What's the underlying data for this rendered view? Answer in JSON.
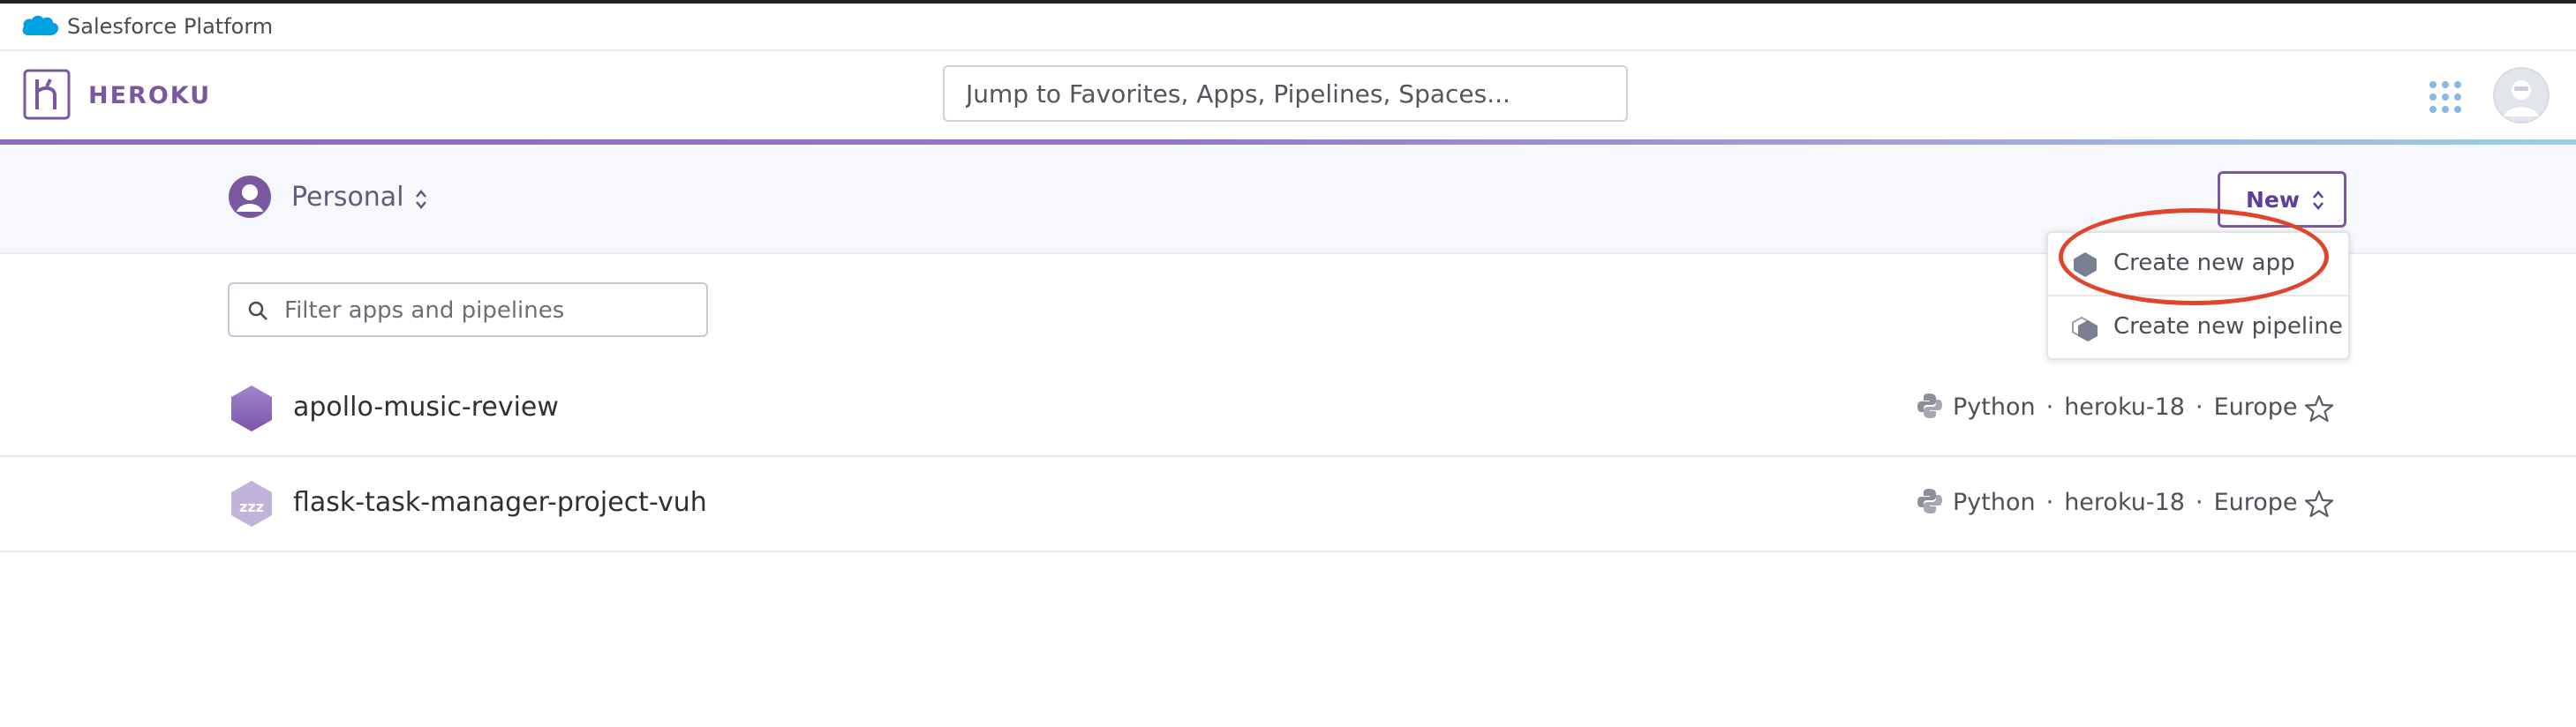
{
  "platform_bar": {
    "title": "Salesforce Platform",
    "icon": "salesforce-cloud-icon"
  },
  "header": {
    "brand": "HEROKU",
    "search_placeholder": "Jump to Favorites, Apps, Pipelines, Spaces...",
    "icons": [
      "heroku-logo-icon",
      "apps-grid-icon",
      "avatar"
    ]
  },
  "subheader": {
    "account_label": "Personal",
    "new_label": "New"
  },
  "new_menu": {
    "items": [
      {
        "label": "Create new app",
        "icon": "app-hexagon-icon"
      },
      {
        "label": "Create new pipeline",
        "icon": "pipeline-icon"
      }
    ]
  },
  "filter": {
    "placeholder": "Filter apps and pipelines"
  },
  "apps": [
    {
      "name": "apollo-music-review",
      "language": "Python",
      "stack": "heroku-18",
      "region": "Europe",
      "status": "active"
    },
    {
      "name": "flask-task-manager-project-vuh",
      "language": "Python",
      "stack": "heroku-18",
      "region": "Europe",
      "status": "sleeping"
    }
  ],
  "colors": {
    "brand": "#79589f",
    "annotation": "#e0442a",
    "salesforce_blue": "#00a1e0"
  }
}
